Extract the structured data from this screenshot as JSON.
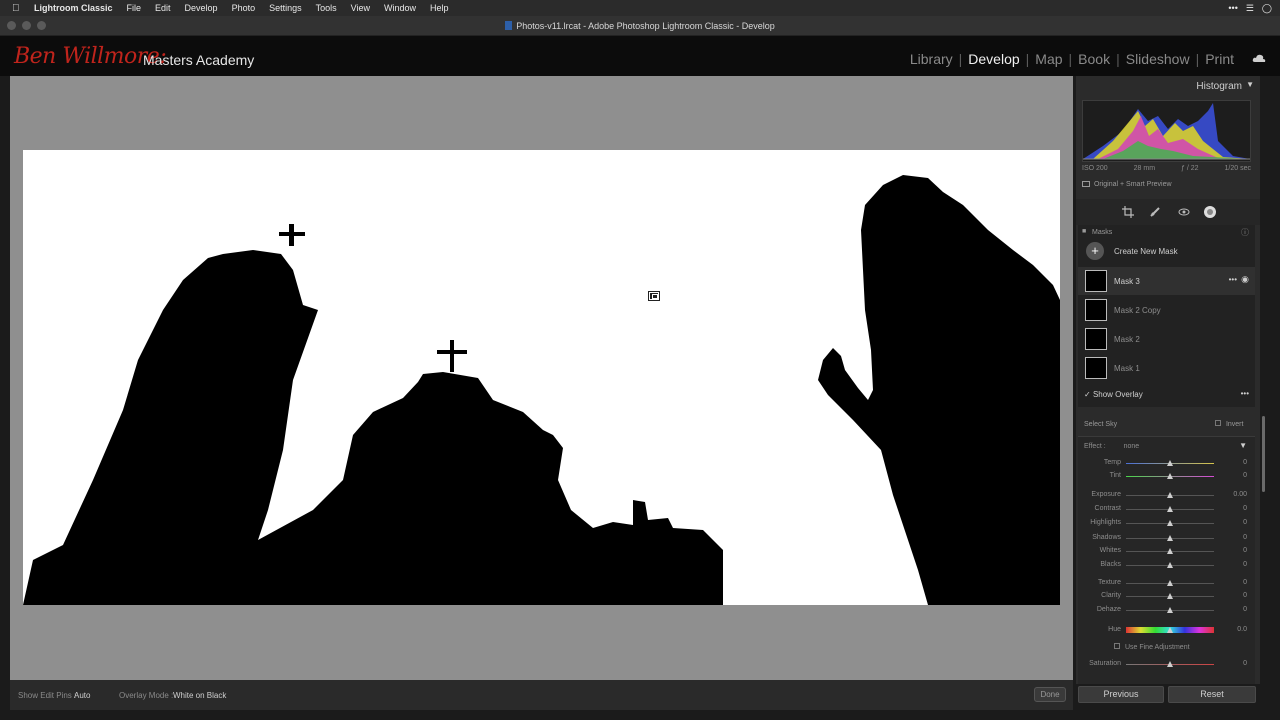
{
  "menubar": {
    "items": [
      "Lightroom Classic",
      "File",
      "Edit",
      "Develop",
      "Photo",
      "Settings",
      "Tools",
      "View",
      "Window",
      "Help"
    ]
  },
  "window": {
    "title": "Photos-v11.lrcat - Adobe Photoshop Lightroom Classic - Develop"
  },
  "identity": {
    "script_name": "Ben Willmore:",
    "brand_text": "Masters Academy",
    "modules": [
      "Library",
      "Develop",
      "Map",
      "Book",
      "Slideshow",
      "Print"
    ],
    "active_module": "Develop"
  },
  "histogram": {
    "title": "Histogram",
    "iso": "ISO 200",
    "focal": "28 mm",
    "aperture": "ƒ / 22",
    "shutter": "1/20 sec",
    "preview": "Original + Smart Preview"
  },
  "masks": {
    "title": "Masks",
    "create_label": "Create New Mask",
    "items": [
      {
        "label": "Mask 3",
        "selected": true
      },
      {
        "label": "Mask 2 Copy",
        "selected": false
      },
      {
        "label": "Mask 2",
        "selected": false
      },
      {
        "label": "Mask 1",
        "selected": false
      }
    ],
    "show_overlay": "Show Overlay",
    "show_overlay_checked": true
  },
  "adjust": {
    "component": "Select Sky",
    "invert": "Invert",
    "effect_label": "Effect :",
    "effect_value": "none",
    "sliders": [
      {
        "label": "Temp",
        "value": "0"
      },
      {
        "label": "Tint",
        "value": "0"
      },
      {
        "label": "Exposure",
        "value": "0.00"
      },
      {
        "label": "Contrast",
        "value": "0"
      },
      {
        "label": "Highlights",
        "value": "0"
      },
      {
        "label": "Shadows",
        "value": "0"
      },
      {
        "label": "Whites",
        "value": "0"
      },
      {
        "label": "Blacks",
        "value": "0"
      },
      {
        "label": "Texture",
        "value": "0"
      },
      {
        "label": "Clarity",
        "value": "0"
      },
      {
        "label": "Dehaze",
        "value": "0"
      },
      {
        "label": "Hue",
        "value": "0.0"
      },
      {
        "label": "Saturation",
        "value": "0"
      }
    ],
    "fine_adjustment": "Use Fine Adjustment"
  },
  "toolbar": {
    "show_pins_label": "Show Edit Pins :",
    "show_pins_value": "Auto",
    "overlay_mode_label": "Overlay Mode :",
    "overlay_mode_value": "White on Black",
    "done": "Done"
  },
  "footer": {
    "previous": "Previous",
    "reset": "Reset"
  },
  "colors": {
    "accent_red": "#c0241c",
    "panel": "#2b2b2b",
    "canvas": "#8f8f8f"
  }
}
